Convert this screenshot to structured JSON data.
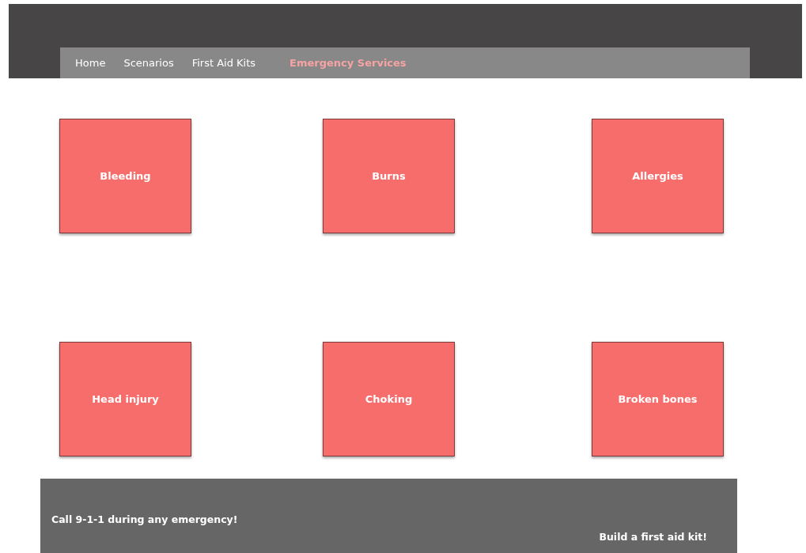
{
  "nav": {
    "items": [
      {
        "label": "Home",
        "selected": false
      },
      {
        "label": "Scenarios",
        "selected": false
      },
      {
        "label": "First Aid Kits",
        "selected": false
      },
      {
        "label": "Emergency Services",
        "selected": true
      }
    ]
  },
  "scenarios": [
    {
      "label": "Bleeding"
    },
    {
      "label": "Burns"
    },
    {
      "label": "Allergies"
    },
    {
      "label": "Head injury"
    },
    {
      "label": "Choking"
    },
    {
      "label": "Broken bones"
    }
  ],
  "footer": {
    "message": "Call 9-1-1 during any emergency!",
    "link": "Build a first aid kit!"
  }
}
